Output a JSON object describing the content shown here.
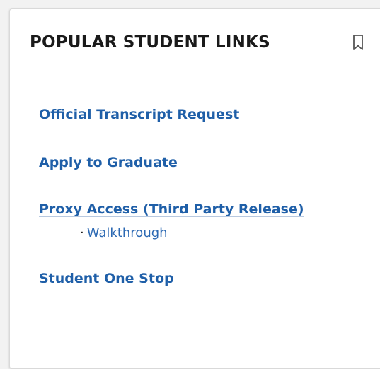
{
  "card": {
    "title": "POPULAR STUDENT LINKS",
    "bookmark_icon": "bookmark-icon"
  },
  "links": [
    {
      "label": "Official Transcript Request"
    },
    {
      "label": "Apply to Graduate"
    },
    {
      "label": "Proxy Access (Third Party Release)",
      "sub_bullet": "·",
      "sub_link": "Walkthrough"
    },
    {
      "label": "Student One Stop"
    }
  ],
  "colors": {
    "link": "#1f5fa8",
    "title": "#1a1a1a",
    "background": "#ffffff"
  }
}
